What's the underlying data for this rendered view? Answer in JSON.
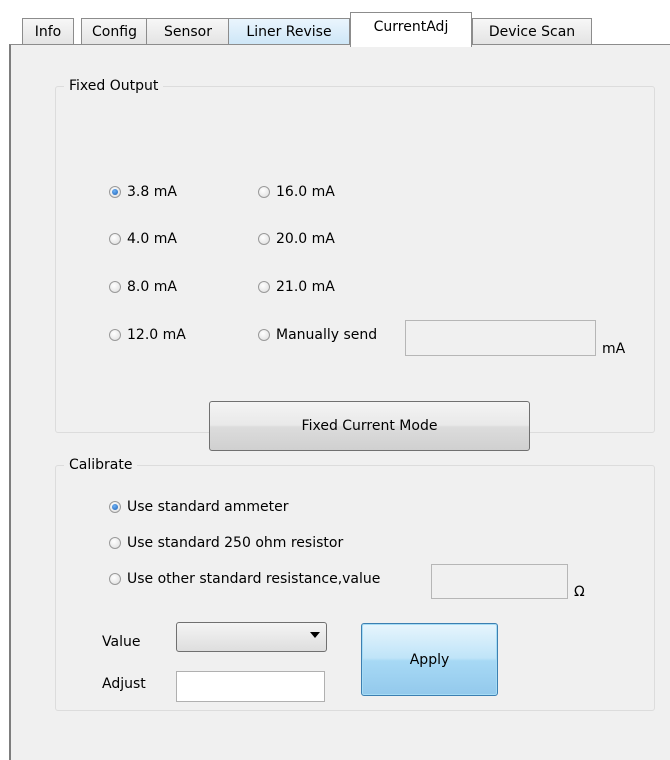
{
  "tabs": [
    {
      "label": "Info"
    },
    {
      "label": "Config"
    },
    {
      "label": "Sensor"
    },
    {
      "label": "Liner Revise"
    },
    {
      "label": "CurrentAdj"
    },
    {
      "label": "Device Scan"
    }
  ],
  "fixed_output": {
    "title": "Fixed Output",
    "options": [
      {
        "label": "3.8 mA",
        "checked": true
      },
      {
        "label": "4.0 mA",
        "checked": false
      },
      {
        "label": "8.0 mA",
        "checked": false
      },
      {
        "label": "12.0 mA",
        "checked": false
      },
      {
        "label": "16.0 mA",
        "checked": false
      },
      {
        "label": "20.0 mA",
        "checked": false
      },
      {
        "label": "21.0 mA",
        "checked": false
      },
      {
        "label": "Manually send",
        "checked": false
      }
    ],
    "manual_value": "",
    "manual_unit": "mA",
    "mode_button": "Fixed Current Mode"
  },
  "calibrate": {
    "title": "Calibrate",
    "options": [
      {
        "label": "Use standard ammeter",
        "checked": true
      },
      {
        "label": "Use standard 250 ohm resistor",
        "checked": false
      },
      {
        "label": "Use other standard resistance,value",
        "checked": false
      }
    ],
    "resistance_value": "",
    "resistance_unit": "Ω",
    "value_label": "Value",
    "value_selected": "",
    "adjust_label": "Adjust",
    "adjust_value": "",
    "apply_button": "Apply"
  }
}
